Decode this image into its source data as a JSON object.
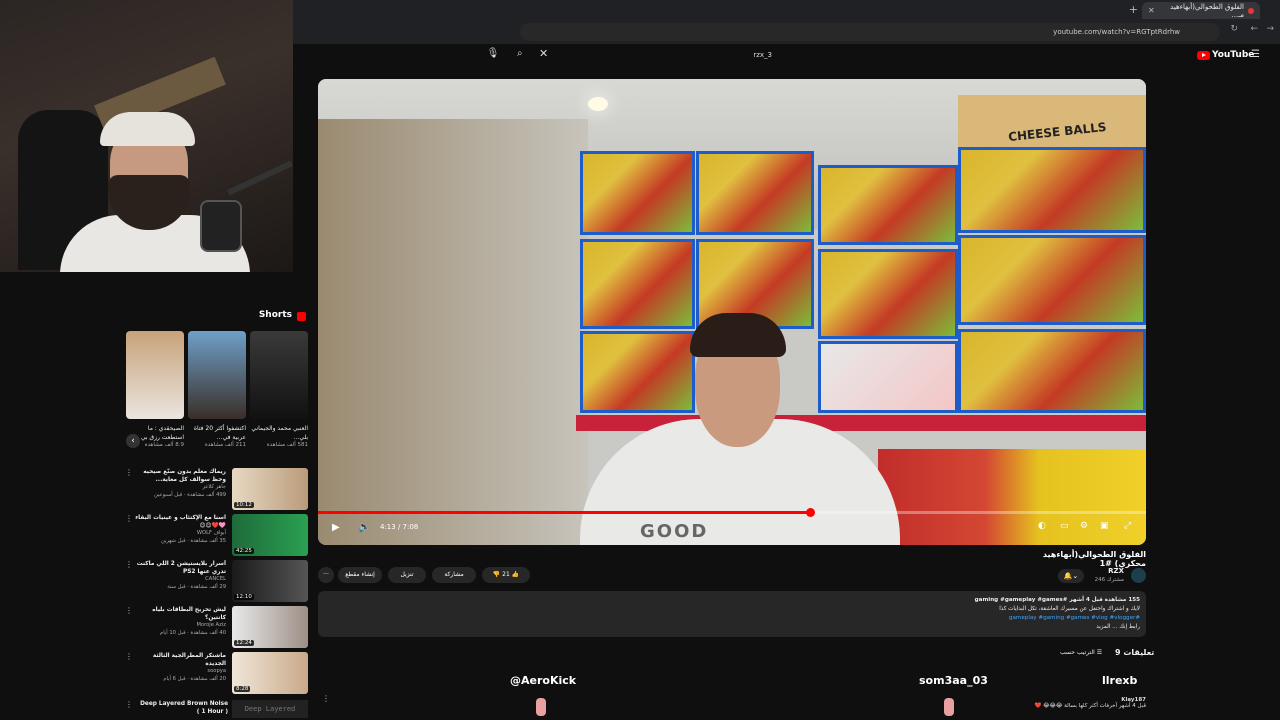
{
  "browser": {
    "tab_title": "الفلوق الطحوالي(أبهاء‌هيد مـ...",
    "new_tab": "+",
    "url": "youtube.com/watch?v=RGTptRdrhw"
  },
  "search": {
    "value": "rzx_3"
  },
  "youtube": {
    "logo": "YouTube"
  },
  "shorts": {
    "title": "Shorts",
    "items": [
      {
        "title": "الصيحقدي : ما استطعت رزق بي الشيخ",
        "views": "8.9 ألف مشاهدة"
      },
      {
        "title": "اكتشفوا أكثر 20 فتاة عربية في…",
        "views": "211 ألف مشاهدة"
      },
      {
        "title": "العنبي محمد والجيماني بلي…",
        "views": "581 ألف مشاهدة"
      }
    ]
  },
  "sidebar_videos": [
    {
      "title": "ريماك معلم بدون صنّع صيحيه وحظ سوالف كل معاية...",
      "channel": "جاهر كلاعر",
      "meta": "499 ألف مشاهدة · قبل أسبوعين",
      "duration": "10:12"
    },
    {
      "title": "اسنا مع الإكتئاب و عينيات البقاء 🩷❤️😊😊",
      "channel": "أبواف WOLF",
      "meta": "35 ألف مشاهدة · قبل شهرين",
      "duration": "42:25"
    },
    {
      "title": "أسرار بلايستيشن 2 اللي ماكنت تدري عنها PS2",
      "channel": "CANCEL",
      "meta": "29 ألف مشاهدة · قبل سنة",
      "duration": "12:10"
    },
    {
      "title": "ليش تحريج البطاقات بلياه كانتين؟",
      "channel": "Moroje Aziz",
      "meta": "40 ألف مشاهدة · قبل 10 أيام",
      "duration": "12:24"
    },
    {
      "title": "ماشتكر المطرالجية الثالثة الجديدة",
      "channel": "soopya",
      "meta": "20 ألف مشاهدة · قبل 6 أيام",
      "duration": "8:28"
    }
  ],
  "deep": {
    "title": "Deep Layered Brown Noise ( 1 Hour )",
    "thumb_label": "Deep Layered"
  },
  "player": {
    "time": "4:13 / 7:08",
    "progress": 0.594,
    "shirt_text": "GOOD",
    "boxes_text": "CHEESE BALLS"
  },
  "video": {
    "title": "الفلوق الطحوالي(أبهاء‌هيد محكري) #1",
    "channel": "RZX",
    "subs": "246 مشترك"
  },
  "actions": {
    "likes": "21",
    "share": "مشاركة",
    "download": "تنزيل",
    "clip": "إنشاء مقطع",
    "more": "···"
  },
  "description": {
    "views": "155 مشاهدة قبل 4 أشهر  #gaming #gameplay #games",
    "line2": "لايك و اشتراك واحتفل عن مسيرك العاشقة، تكل البدايات كذا",
    "tags": "#gameplay #gaming #games #vlog #vlogger",
    "more": "رابط إنك ... المزيد"
  },
  "comments": {
    "title": "9 تعليقات",
    "sort": "الترتيب حسب",
    "sample_user": "Klay187",
    "sample_text": "قبل 4 أشهر  آخرفات أكثر كلها بسالة 😂😂😂 ❤️"
  },
  "chat": {
    "names": [
      "@AeroKick",
      "som3aa_03",
      "llrexb"
    ]
  }
}
